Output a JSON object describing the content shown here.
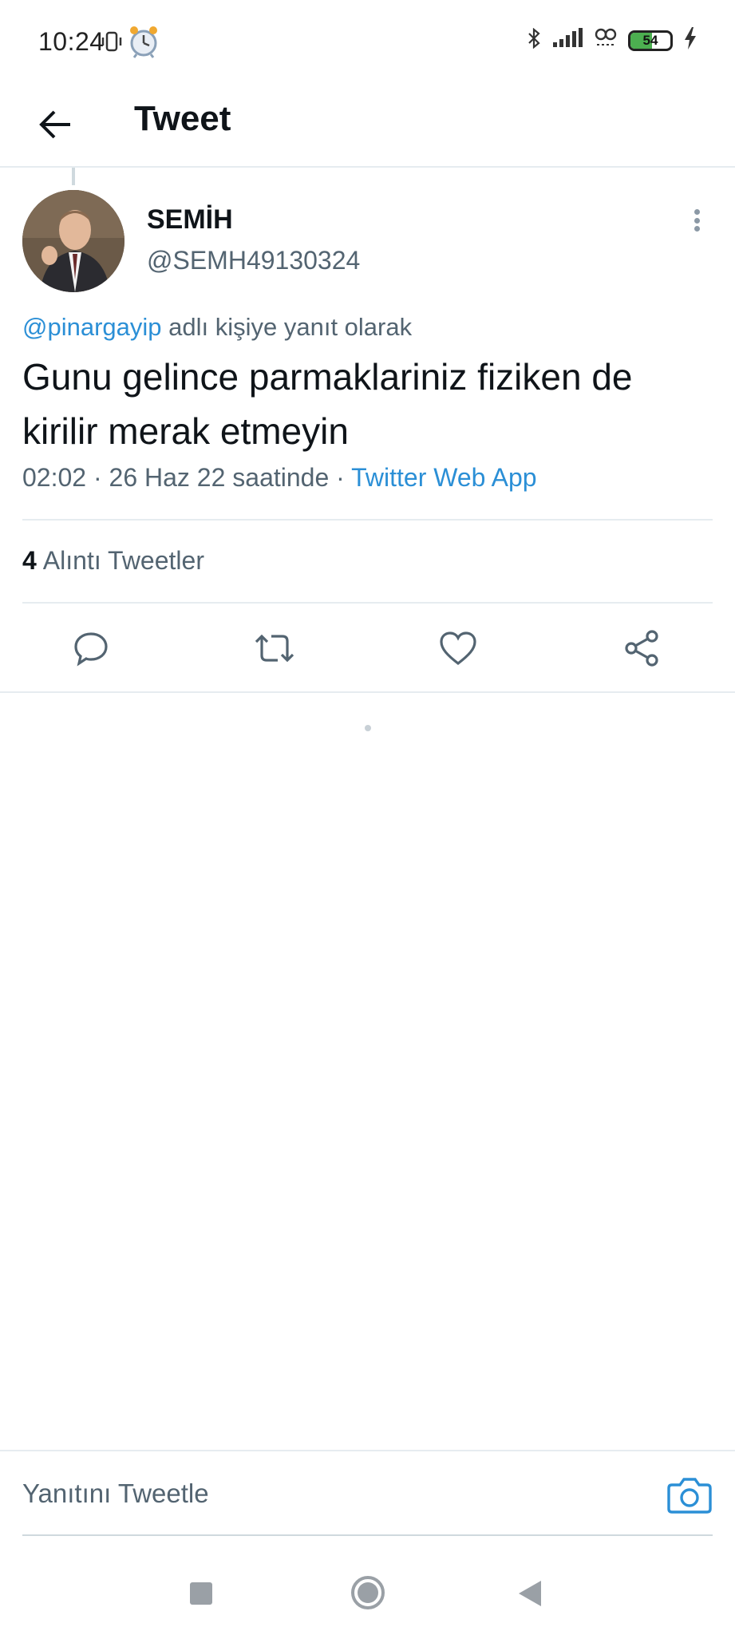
{
  "status_bar": {
    "time": "10:24",
    "battery_level": "54",
    "battery_fraction": 0.54,
    "icons": [
      "vibrate-icon",
      "alarm-clock-icon",
      "bluetooth-icon",
      "signal-icon",
      "wifi-icon",
      "battery-icon",
      "charging-icon"
    ]
  },
  "header": {
    "title": "Tweet",
    "back_icon": "arrow-left-icon"
  },
  "tweet": {
    "author_name": "SEMİH",
    "author_handle": "@SEMH49130324",
    "reply_to_handle": "@pinargayip",
    "reply_context_suffix": " adlı kişiye yanıt olarak",
    "text": "Gunu gelince parmaklariniz fiziken de kirilir merak etmeyin",
    "meta_time": "02:02 · 26 Haz 22 saatinde · ",
    "source": "Twitter Web App",
    "quote_count": "4",
    "quote_label": "Alıntı Tweetler"
  },
  "actions": [
    {
      "name": "reply",
      "icon": "comment-icon"
    },
    {
      "name": "retweet",
      "icon": "retweet-icon"
    },
    {
      "name": "like",
      "icon": "heart-icon"
    },
    {
      "name": "share",
      "icon": "share-icon"
    }
  ],
  "composer": {
    "placeholder": "Yanıtını Tweetle",
    "camera_icon": "camera-icon"
  },
  "colors": {
    "accent": "#2b8fd6",
    "secondary_text": "#536471",
    "divider": "#e6ecf0",
    "battery_fill": "#4caf50"
  }
}
